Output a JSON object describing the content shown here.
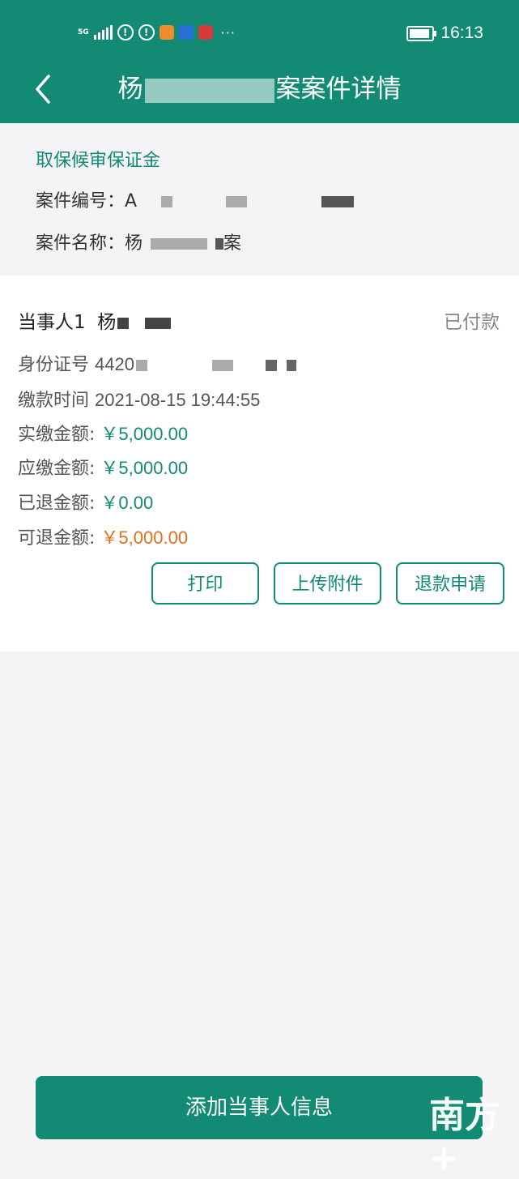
{
  "status_bar": {
    "network": "5G",
    "time": "16:13",
    "more": "···"
  },
  "nav": {
    "title_prefix": "杨",
    "title_suffix": "案案件详情"
  },
  "case": {
    "type": "取保候审保证金",
    "number_label": "案件编号：",
    "number_value": "A",
    "name_label": "案件名称：",
    "name_value_start": "杨",
    "name_value_end": "案"
  },
  "party": {
    "title": "当事人1",
    "name": "杨",
    "status": "已付款",
    "id_label": "身份证号",
    "id_value": "4420",
    "time_label": "缴款时间",
    "time_value": "2021-08-15 19:44:55",
    "paid_label": "实缴金额:",
    "paid_value": "￥5,000.00",
    "due_label": "应缴金额:",
    "due_value": "￥5,000.00",
    "refunded_label": "已退金额:",
    "refunded_value": "￥0.00",
    "refundable_label": "可退金额:",
    "refundable_value": "￥5,000.00"
  },
  "actions": {
    "print": "打印",
    "upload": "上传附件",
    "refund": "退款申请"
  },
  "add_party_button": "添加当事人信息",
  "watermark": "南方+",
  "colors": {
    "brand": "#128a74",
    "highlight": "#e1701a"
  }
}
